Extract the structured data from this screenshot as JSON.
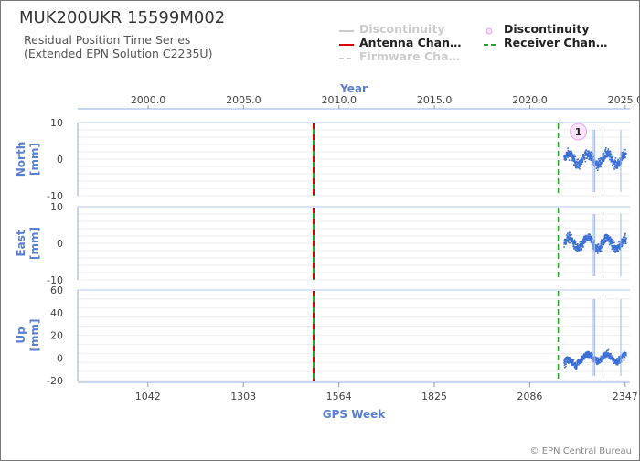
{
  "header": {
    "title": "MUK200UKR 15599M002",
    "subtitle_line1": "Residual Position Time Series",
    "subtitle_line2": "(Extended EPN Solution C2235U)"
  },
  "legend": {
    "items": [
      {
        "label": "Discontinuity",
        "symbol": "line",
        "color": "#cccccc",
        "dimmed": true
      },
      {
        "label": "Discontinuity",
        "symbol": "circle",
        "color": "#e8a5e8",
        "dimmed": false
      },
      {
        "label": "Antenna Chan…",
        "symbol": "line",
        "color": "#dd0000",
        "dimmed": false
      },
      {
        "label": "Receiver Chan…",
        "symbol": "dash",
        "color": "#22aa22",
        "dimmed": false
      },
      {
        "label": "Firmware Cha…",
        "symbol": "dash",
        "color": "#cccccc",
        "dimmed": true
      }
    ]
  },
  "credit": "© EPN Central Bureau",
  "chart_data": {
    "type": "scatter",
    "top_axis": {
      "label": "Year",
      "ticks": [
        "2000.0",
        "2005.0",
        "2010.0",
        "2015.0",
        "2020.0",
        "2025.0"
      ]
    },
    "bottom_axis": {
      "label": "GPS Week",
      "ticks": [
        "1042",
        "1303",
        "1564",
        "1825",
        "2086",
        "2347"
      ]
    },
    "xlim_gps_week": [
      850,
      2360
    ],
    "antenna_change_gps_week": 1495,
    "receiver_change_gps_week": 2164,
    "discontinuity_marker": {
      "gps_week": 2214,
      "label": "1"
    },
    "series_color": "#3b6fd6",
    "panels": [
      {
        "name": "North",
        "unit": "[mm]",
        "ylim": [
          -10,
          10
        ],
        "yticks": [
          "10",
          "0",
          "-10"
        ]
      },
      {
        "name": "East",
        "unit": "[mm]",
        "ylim": [
          -10,
          10
        ],
        "yticks": [
          "10",
          "0",
          "-10"
        ]
      },
      {
        "name": "Up",
        "unit": "[mm]",
        "ylim": [
          -20,
          60
        ],
        "yticks": [
          "60",
          "40",
          "20",
          "0",
          "-20"
        ]
      }
    ],
    "data_gps_week_range": [
      2180,
      2350
    ]
  }
}
